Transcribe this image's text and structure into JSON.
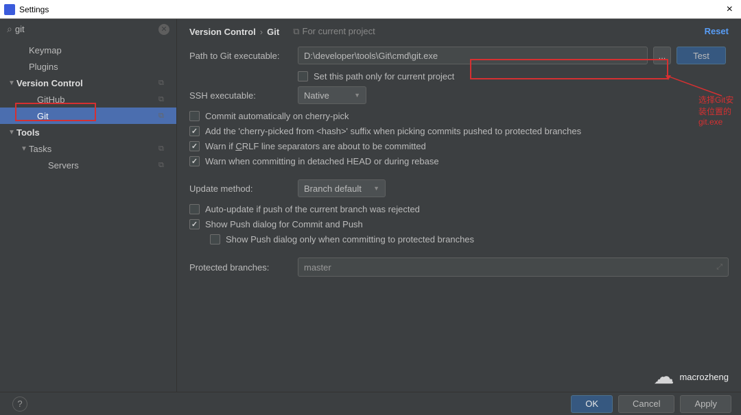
{
  "window": {
    "title": "Settings",
    "close": "×"
  },
  "search": {
    "value": "git"
  },
  "sidebar": {
    "items": [
      {
        "label": "Keymap"
      },
      {
        "label": "Plugins"
      },
      {
        "label": "Version Control",
        "copy": true,
        "expandable": true
      },
      {
        "label": "GitHub",
        "copy": true
      },
      {
        "label": "Git",
        "copy": true,
        "selected": true
      },
      {
        "label": "Tools",
        "expandable": true
      },
      {
        "label": "Tasks",
        "copy": true,
        "expandable": true
      },
      {
        "label": "Servers",
        "copy": true
      }
    ]
  },
  "breadcrumb": {
    "parent": "Version Control",
    "current": "Git",
    "scope": "For current project"
  },
  "reset": "Reset",
  "form": {
    "path_label": "Path to Git executable:",
    "path_value": "D:\\developer\\tools\\Git\\cmd\\git.exe",
    "browse": "...",
    "test": "Test",
    "set_path_only": "Set this path only for current project",
    "ssh_label": "SSH executable:",
    "ssh_value": "Native",
    "update_label": "Update method:",
    "update_value": "Branch default",
    "protected_label": "Protected branches:",
    "protected_value": "master",
    "checks": {
      "commit_auto": "Commit automatically on cherry-pick",
      "add_cherry": "Add the 'cherry-picked from <hash>' suffix when picking commits pushed to protected branches",
      "warn_crlf_pre": "Warn if ",
      "warn_crlf_u": "C",
      "warn_crlf_post": "RLF line separators are about to be committed",
      "warn_detached": "Warn when committing in detached HEAD or during rebase",
      "auto_update": "Auto-update if push of the current branch was rejected",
      "show_push": "Show Push dialog for Commit and Push",
      "show_push_protected": "Show Push dialog only when committing to protected branches"
    }
  },
  "annotation": "选择Git安装位置的git.exe",
  "footer": {
    "ok": "OK",
    "cancel": "Cancel",
    "apply": "Apply"
  },
  "watermark": "macrozheng"
}
